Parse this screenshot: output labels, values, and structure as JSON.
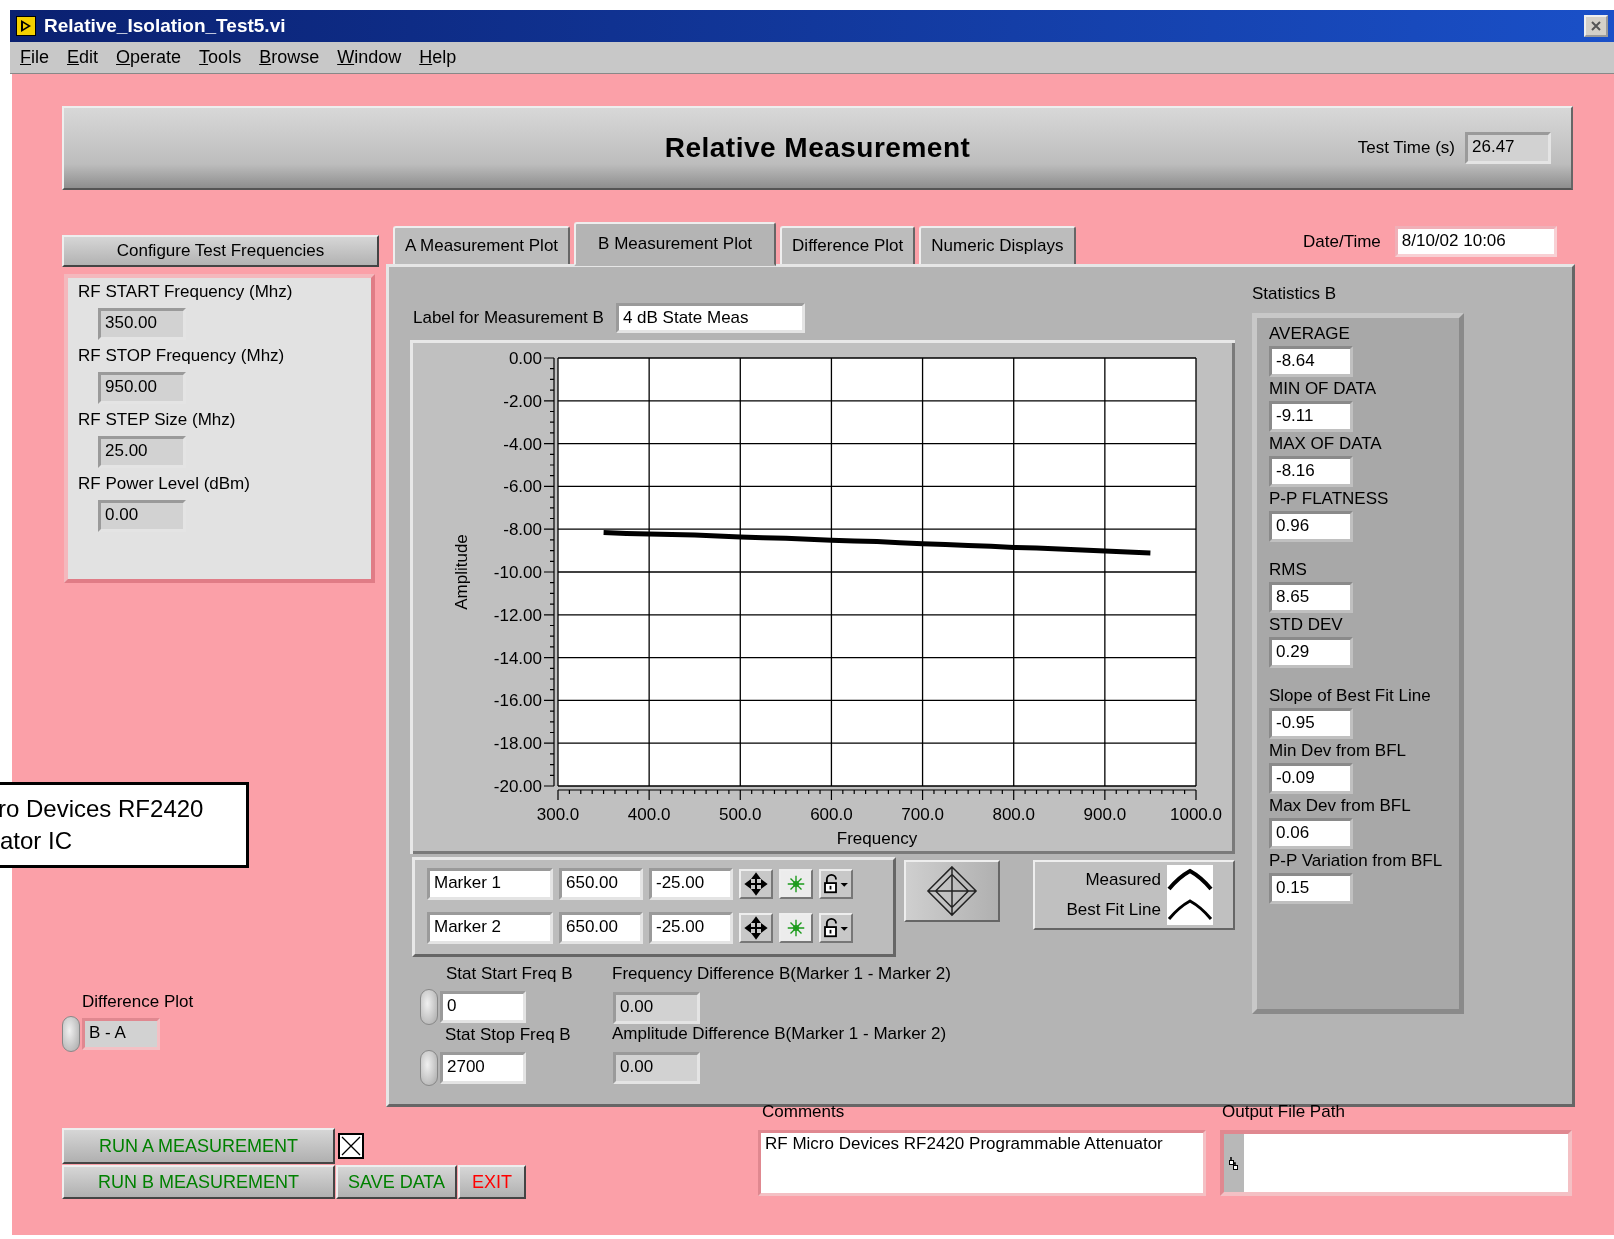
{
  "window": {
    "title": "Relative_Isolation_Test5.vi"
  },
  "menu": [
    {
      "label": "File"
    },
    {
      "label": "Edit"
    },
    {
      "label": "Operate"
    },
    {
      "label": "Tools"
    },
    {
      "label": "Browse"
    },
    {
      "label": "Window"
    },
    {
      "label": "Help"
    }
  ],
  "header": {
    "title": "Relative Measurement",
    "test_time": {
      "label": "Test Time (s)",
      "value": "26.47"
    }
  },
  "configure_button": "Configure Test Frequencies",
  "rf_settings": [
    {
      "label": "RF START Frequency (Mhz)",
      "value": "350.00"
    },
    {
      "label": "RF STOP Frequency (Mhz)",
      "value": "950.00"
    },
    {
      "label": "RF STEP Size (Mhz)",
      "value": "25.00"
    },
    {
      "label": "RF Power Level (dBm)",
      "value": "0.00"
    }
  ],
  "tabs": [
    {
      "label": "A Measurement Plot",
      "selected": false
    },
    {
      "label": "B Measurement Plot",
      "selected": true
    },
    {
      "label": "Difference Plot",
      "selected": false
    },
    {
      "label": "Numeric Displays",
      "selected": false
    }
  ],
  "date_time": {
    "label": "Date/Time",
    "value": "8/10/02  10:06"
  },
  "measurement_label": {
    "label": "Label for Measurement B",
    "value": "4 dB State Meas"
  },
  "chart_data": {
    "type": "line",
    "xlabel": "Frequency",
    "ylabel": "Amplitude",
    "x": [
      350,
      375,
      400,
      425,
      450,
      475,
      500,
      525,
      550,
      575,
      600,
      625,
      650,
      675,
      700,
      725,
      750,
      775,
      800,
      825,
      850,
      875,
      900,
      925,
      950
    ],
    "grid": true,
    "series": [
      {
        "color": "#000000",
        "values": [
          -8.16,
          -8.2,
          -8.22,
          -8.25,
          -8.27,
          -8.32,
          -8.36,
          -8.4,
          -8.42,
          -8.47,
          -8.52,
          -8.55,
          -8.58,
          -8.63,
          -8.68,
          -8.72,
          -8.76,
          -8.8,
          -8.85,
          -8.88,
          -8.93,
          -8.97,
          -9.02,
          -9.07,
          -9.11
        ]
      }
    ],
    "xlim": [
      300,
      1000
    ],
    "ylim": [
      -20,
      0
    ],
    "xticks": [
      {
        "value": 300,
        "label": "300.0"
      },
      {
        "value": 400,
        "label": "400.0"
      },
      {
        "value": 500,
        "label": "500.0"
      },
      {
        "value": 600,
        "label": "600.0"
      },
      {
        "value": 700,
        "label": "700.0"
      },
      {
        "value": 800,
        "label": "800.0"
      },
      {
        "value": 900,
        "label": "900.0"
      },
      {
        "value": 1000,
        "label": "1000.0"
      }
    ],
    "yticks": [
      {
        "value": 0,
        "label": "0.00"
      },
      {
        "value": -2,
        "label": "-2.00"
      },
      {
        "value": -4,
        "label": "-4.00"
      },
      {
        "value": -6,
        "label": "-6.00"
      },
      {
        "value": -8,
        "label": "-8.00"
      },
      {
        "value": -10,
        "label": "-10.00"
      },
      {
        "value": -12,
        "label": "-12.00"
      },
      {
        "value": -14,
        "label": "-14.00"
      },
      {
        "value": -16,
        "label": "-16.00"
      },
      {
        "value": -18,
        "label": "-18.00"
      },
      {
        "value": -20,
        "label": "-20.00"
      }
    ]
  },
  "markers": [
    {
      "name": "Marker 1",
      "frequency": "650.00",
      "amplitude": "-25.00"
    },
    {
      "name": "Marker 2",
      "frequency": "650.00",
      "amplitude": "-25.00"
    }
  ],
  "legend": [
    {
      "name": "Measured"
    },
    {
      "name": "Best Fit Line"
    }
  ],
  "stat_start": {
    "label": "Stat Start Freq B",
    "value": "0"
  },
  "stat_stop": {
    "label": "Stat Stop Freq B",
    "value": "2700"
  },
  "frequency_difference": {
    "label": "Frequency Difference B(Marker 1 - Marker 2)",
    "value": "0.00"
  },
  "amplitude_difference": {
    "label": "Amplitude Difference B(Marker 1 - Marker 2)",
    "value": "0.00"
  },
  "statistics": {
    "title": "Statistics B",
    "groups": [
      [
        {
          "label": "AVERAGE",
          "value": "-8.64"
        },
        {
          "label": "MIN OF DATA",
          "value": "-9.11"
        },
        {
          "label": "MAX OF DATA",
          "value": "-8.16"
        },
        {
          "label": "P-P FLATNESS",
          "value": "0.96"
        }
      ],
      [
        {
          "label": "RMS",
          "value": "8.65"
        },
        {
          "label": "STD DEV",
          "value": "0.29"
        }
      ],
      [
        {
          "label": "Slope of Best Fit Line",
          "value": "-0.95"
        },
        {
          "label": "Min Dev from BFL",
          "value": "-0.09"
        },
        {
          "label": "Max Dev from BFL",
          "value": "0.06"
        },
        {
          "label": "P-P Variation from BFL",
          "value": "0.15"
        }
      ]
    ]
  },
  "difference_plot": {
    "label": "Difference Plot",
    "value": "B - A"
  },
  "buttons": [
    {
      "label": "RUN A MEASUREMENT",
      "color": "#008000"
    },
    {
      "label": "RUN B MEASUREMENT",
      "color": "#008000"
    },
    {
      "label": "SAVE DATA",
      "color": "#008000"
    },
    {
      "label": "EXIT",
      "color": "#ff0000"
    }
  ],
  "run_a_checkbox": {
    "checked": true
  },
  "comments": {
    "label": "Comments",
    "value": "RF Micro Devices RF2420 Programmable Attenuator"
  },
  "output_file_path": {
    "label": "Output File Path"
  },
  "tooltip": {
    "lines": [
      "ro Devices RF2420",
      "ator IC"
    ]
  }
}
